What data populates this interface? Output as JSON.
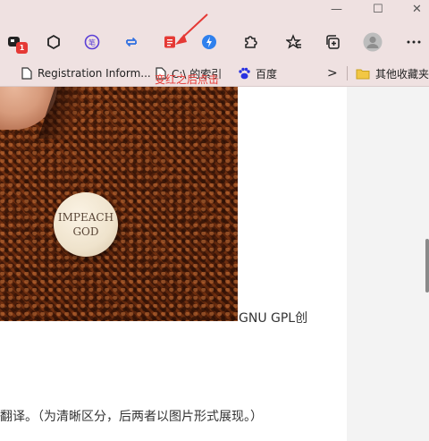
{
  "window": {
    "minimize_label": "—",
    "maximize_label": "☐",
    "close_label": "✕"
  },
  "toolbar": {
    "ext_badge": "1",
    "annotation": "变红之后点击",
    "icons": [
      "extension-badge-icon",
      "hexagon-icon",
      "translate-icon",
      "sync-icon",
      "reader-icon",
      "bolt-icon",
      "puzzle-icon",
      "favorites-icon",
      "collections-icon",
      "profile-icon",
      "more-icon"
    ]
  },
  "bookmarks": {
    "items": [
      {
        "label": "Registration Inform..."
      },
      {
        "label": "C:\\ 的索引"
      },
      {
        "label": "百度"
      }
    ],
    "chevron": ">",
    "other_label": "其他收藏夹"
  },
  "image": {
    "pin_line1": "IMPEACH",
    "pin_line2": "GOD"
  },
  "content": {
    "line1": "GNU GPL创",
    "line2": "翻译。（为清晰区分，后两者以图片形式展现。）"
  },
  "colors": {
    "chrome": "#efe1e1",
    "annotation": "#e53935",
    "accent": "#2f6fe0"
  }
}
